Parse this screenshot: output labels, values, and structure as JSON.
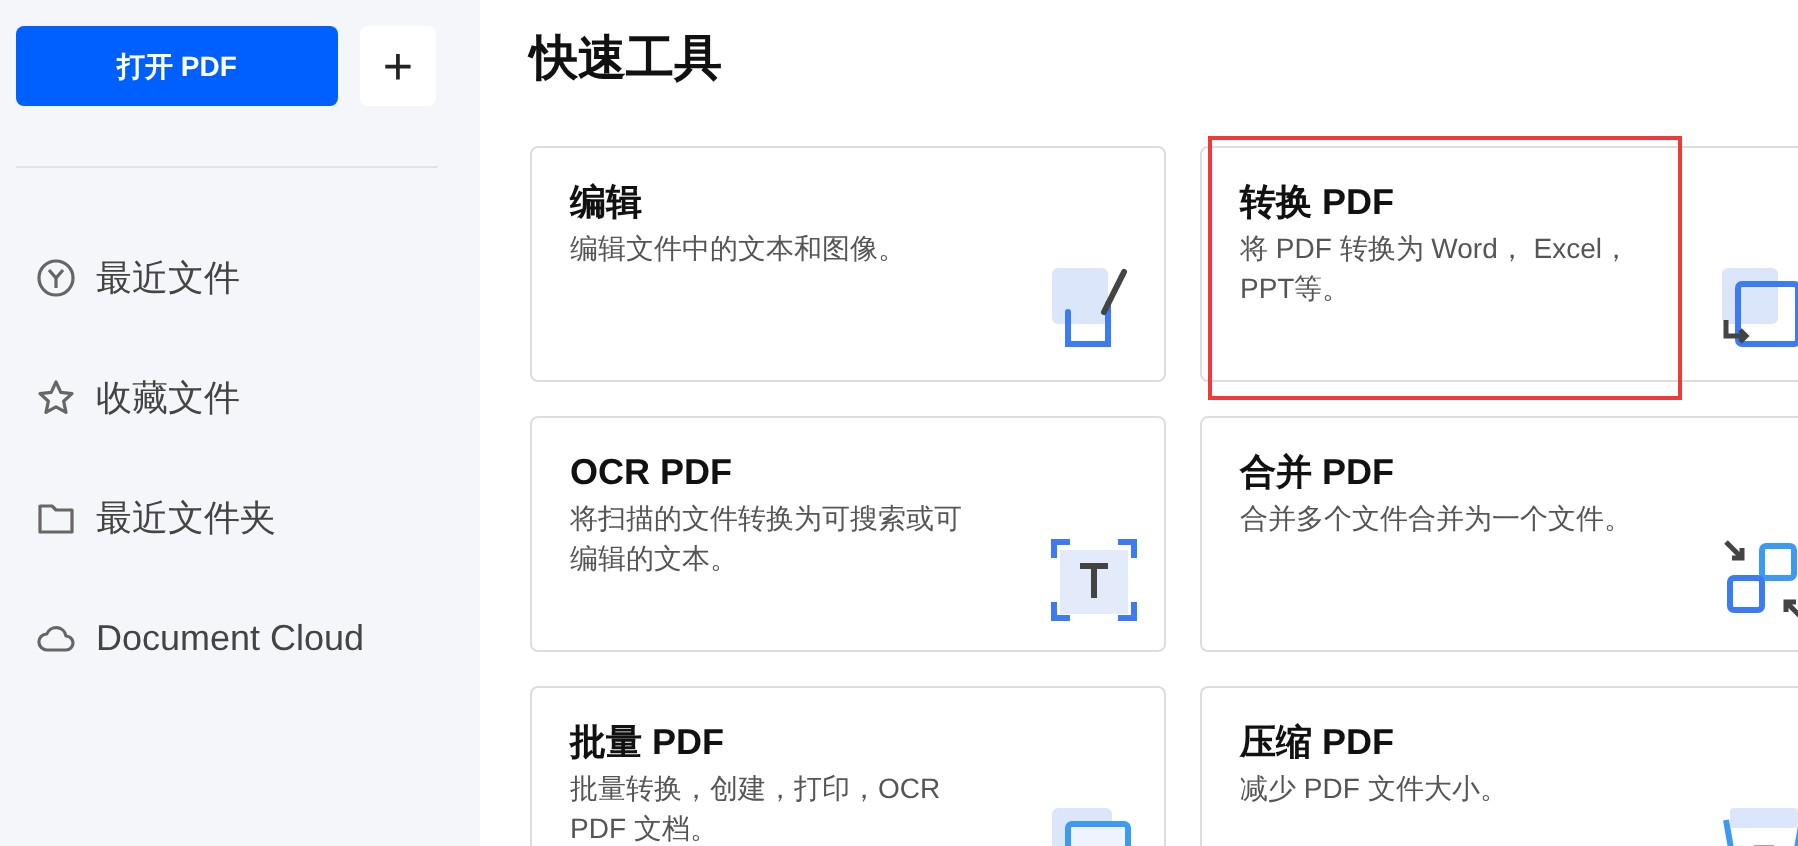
{
  "sidebar": {
    "open_button": "打开 PDF",
    "add_button": "+",
    "items": [
      {
        "kind": "recent",
        "label": "最近文件"
      },
      {
        "kind": "starred",
        "label": "收藏文件"
      },
      {
        "kind": "folder",
        "label": "最近文件夹"
      },
      {
        "kind": "cloud",
        "label": "Document Cloud"
      }
    ]
  },
  "title": "快速工具",
  "tools": [
    {
      "kind": "edit",
      "title": "编辑",
      "description": "编辑文件中的文本和图像。",
      "highlighted": false
    },
    {
      "kind": "convert",
      "title": "转换 PDF",
      "description": "将 PDF 转换为 Word， Excel，\nPPT等。",
      "highlighted": true
    },
    {
      "kind": "ocr",
      "title": "OCR PDF",
      "description": "将扫描的文件转换为可搜索或可编辑的文本。",
      "highlighted": false
    },
    {
      "kind": "merge",
      "title": "合并 PDF",
      "description": "合并多个文件合并为一个文件。",
      "highlighted": false
    },
    {
      "kind": "batch",
      "title": "批量 PDF",
      "description": "批量转换，创建，打印，OCR\nPDF 文档。",
      "highlighted": false
    },
    {
      "kind": "compress",
      "title": "压缩 PDF",
      "description": "减少 PDF 文件大小。",
      "highlighted": false
    }
  ]
}
